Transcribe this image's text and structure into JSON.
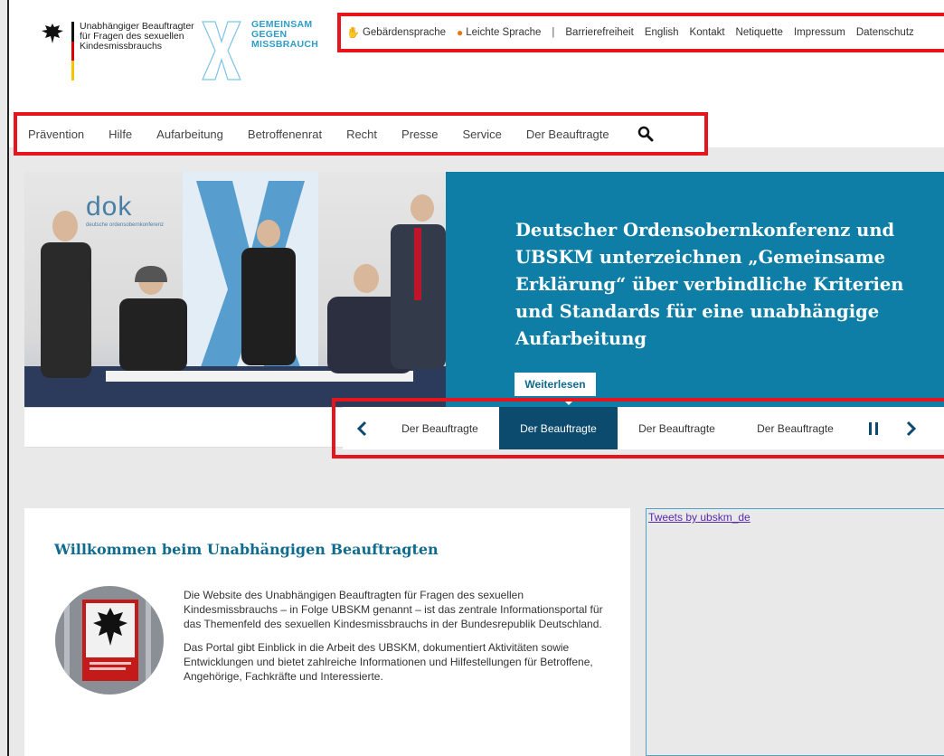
{
  "logo": {
    "line1": "Unabhängiger Beauftragter",
    "line2": "für Fragen des sexuellen",
    "line3": "Kindesmissbrauchs"
  },
  "campaign_logo": {
    "line1": "GEMEINSAM",
    "line2": "GEGEN",
    "line3": "MISSBRAUCH"
  },
  "topnav": {
    "sign_language": "Gebärdensprache",
    "easy_language": "Leichte Sprache",
    "separator": "|",
    "accessibility": "Barrierefreiheit",
    "english": "English",
    "contact": "Kontakt",
    "netiquette": "Netiquette",
    "imprint": "Impressum",
    "privacy": "Datenschutz"
  },
  "mainnav": {
    "items": [
      "Prävention",
      "Hilfe",
      "Aufarbeitung",
      "Betroffenenrat",
      "Recht",
      "Presse",
      "Service",
      "Der Beauftragte"
    ]
  },
  "hero": {
    "photo_label": "dok",
    "photo_sublabel": "deutsche ordensobernkonferenz",
    "title": "Deutscher Ordensobernkonferenz und UBSKM unterzeichnen „Gemeinsame Erklärung“ über verbindliche Kriterien und Standards für eine unabhängige Aufarbeitung",
    "read_more": "Weiterlesen"
  },
  "slider": {
    "tabs": [
      "Der Beauftragte",
      "Der Beauftragte",
      "Der Beauftragte",
      "Der Beauftragte"
    ],
    "active_index": 1
  },
  "welcome": {
    "title": "Willkommen beim Unabhängigen Beauftragten",
    "para1": "Die Website des Unabhängigen Beauftragten für Fragen des sexuellen Kindesmissbrauchs – in Folge UBSKM genannt – ist das zentrale Informationsportal für das Themenfeld des sexuellen Kindesmissbrauchs in der Bundesrepublik Deutschland.",
    "para2": "Das Portal gibt Einblick in die Arbeit des UBSKM, dokumentiert Aktivitäten sowie Entwicklungen und bietet zahlreiche Informationen und Hilfestellungen für Betroffene, Angehörige, Fachkräfte und Interessierte."
  },
  "tweets": {
    "link": "Tweets by ubskm_de"
  },
  "colors": {
    "accent": "#0f7ea6",
    "active_tab": "#0c4a6e",
    "highlight_box": "#e8141b",
    "sign_icon": "#e07a13"
  },
  "icons": {
    "search": "search-icon",
    "prev": "chevron-left-icon",
    "next": "chevron-right-icon",
    "pause": "pause-icon",
    "hand": "hand-icon",
    "eagle": "federal-eagle-icon"
  }
}
